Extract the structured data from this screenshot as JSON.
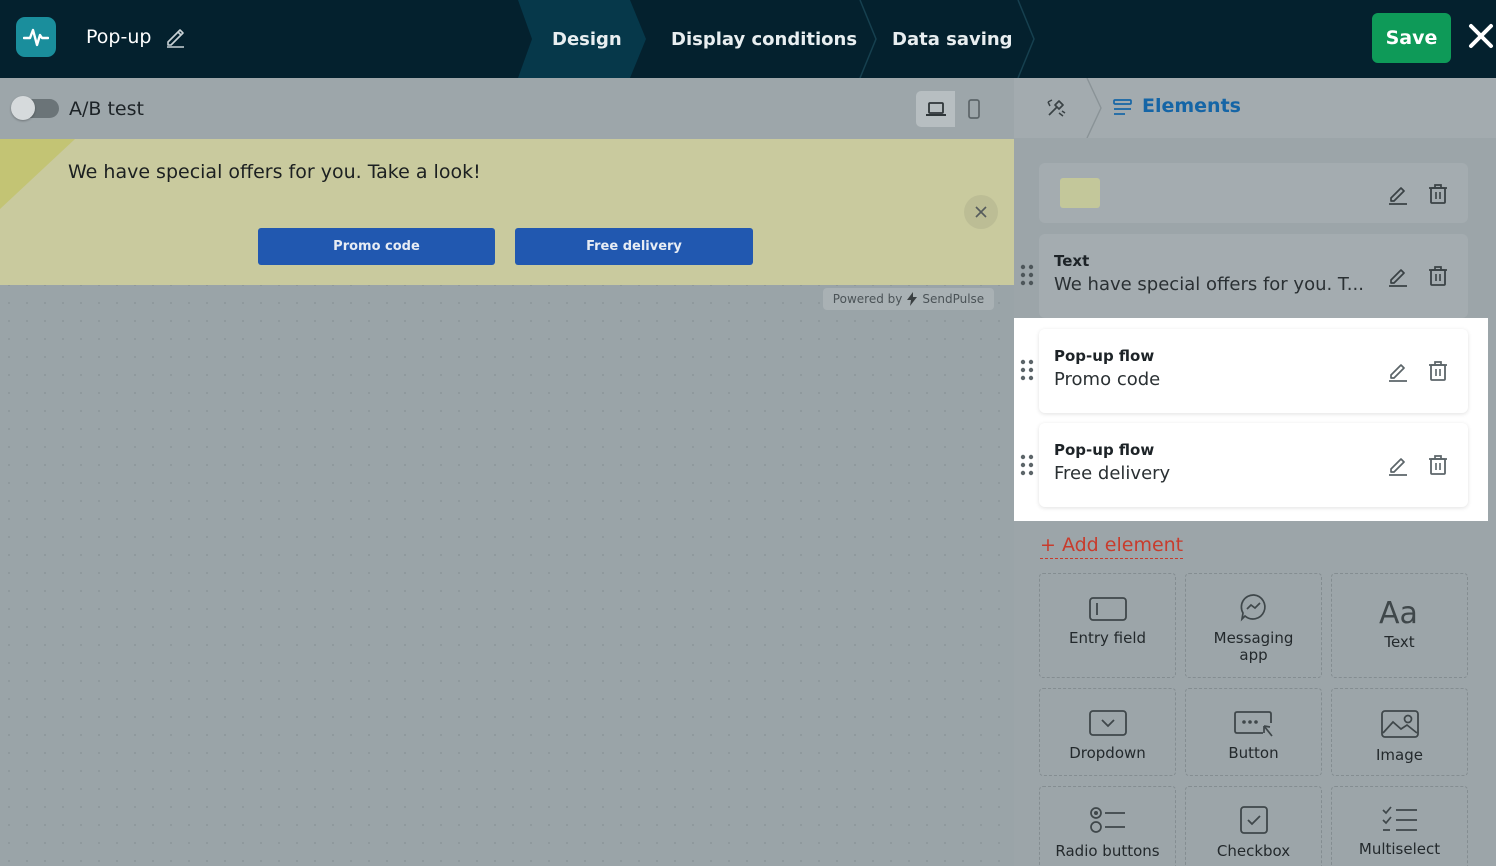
{
  "header": {
    "title": "Pop-up",
    "steps": [
      "Design",
      "Display conditions",
      "Data saving"
    ],
    "save_label": "Save"
  },
  "workspace": {
    "ab_test_label": "A/B test",
    "ab_test_enabled": false,
    "device_selected": "desktop"
  },
  "popup": {
    "message": "We have special offers for you. Take a look!",
    "buttons": [
      "Promo code",
      "Free delivery"
    ],
    "powered_prefix": "Powered by",
    "powered_brand": "SendPulse"
  },
  "panel": {
    "title": "Elements",
    "items": [
      {
        "type": "image"
      },
      {
        "label": "Text",
        "value": "We have special offers for you. T..."
      },
      {
        "label": "Pop-up flow",
        "value": "Promo code"
      },
      {
        "label": "Pop-up flow",
        "value": "Free delivery"
      }
    ],
    "add_label": "+ Add element",
    "tiles": [
      {
        "label": "Entry field",
        "icon": "entry-field-icon"
      },
      {
        "label": "Messaging app",
        "icon": "messaging-app-icon"
      },
      {
        "label": "Text",
        "icon": "text-icon"
      },
      {
        "label": "Dropdown",
        "icon": "dropdown-icon"
      },
      {
        "label": "Button",
        "icon": "button-icon"
      },
      {
        "label": "Image",
        "icon": "image-icon"
      },
      {
        "label": "Radio buttons",
        "icon": "radio-buttons-icon"
      },
      {
        "label": "Checkbox",
        "icon": "checkbox-icon"
      },
      {
        "label": "Multiselect",
        "icon": "multiselect-icon"
      }
    ]
  },
  "colors": {
    "topbar": "#04212e",
    "save": "#0e9a58",
    "accent_blue": "#1565a6",
    "popup_button": "#2158b0",
    "add_element": "#c83c2d"
  }
}
